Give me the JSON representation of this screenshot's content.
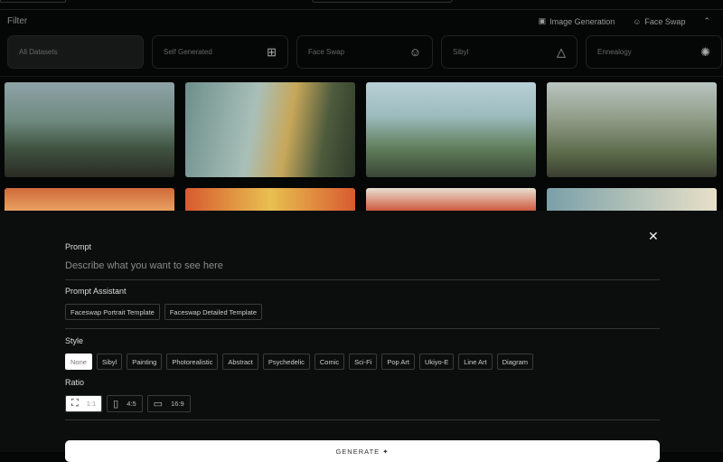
{
  "filter": {
    "label": "Filter",
    "links": [
      {
        "label": "Image Generation",
        "icon": "image-generation-icon"
      },
      {
        "label": "Face Swap",
        "icon": "face-swap-icon"
      }
    ],
    "collapse_icon": "chevron-up-icon"
  },
  "datasets": [
    {
      "label": "All Datasets",
      "icon": ""
    },
    {
      "label": "Self Generated",
      "icon": "sparkle-frame-icon"
    },
    {
      "label": "Face Swap",
      "icon": "face-icon"
    },
    {
      "label": "Sibyl",
      "icon": "triangle-icon"
    },
    {
      "label": "Ennealogy",
      "icon": "snowflake-icon"
    }
  ],
  "panel": {
    "prompt_label": "Prompt",
    "prompt_placeholder": "Describe what you want to see here",
    "assistant_label": "Prompt Assistant",
    "assistant_templates": [
      "Faceswap Portrait Template",
      "Faceswap Detailed Template"
    ],
    "style_label": "Style",
    "styles": [
      "None",
      "Sibyl",
      "Painting",
      "Photorealistic",
      "Abstract",
      "Psychedelic",
      "Comic",
      "Sci-Fi",
      "Pop Art",
      "Ukiyo-E",
      "Line Art",
      "Diagram"
    ],
    "selected_style": "None",
    "ratio_label": "Ratio",
    "ratios": [
      "1:1",
      "4:5",
      "16:9"
    ],
    "selected_ratio": "1:1",
    "generate_label": "GENERATE"
  }
}
